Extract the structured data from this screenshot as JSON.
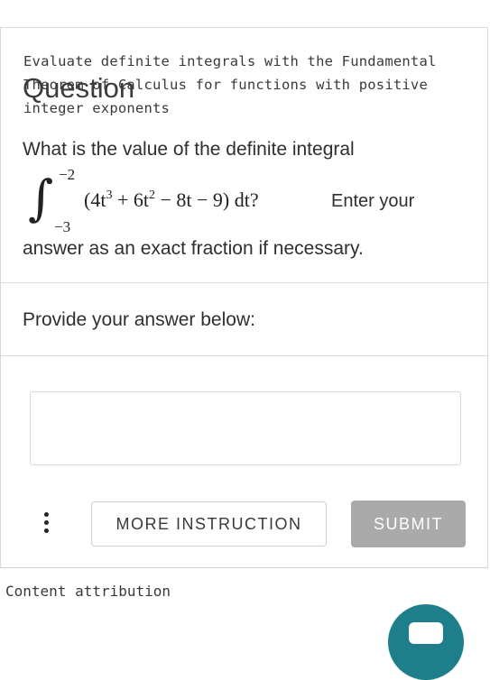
{
  "topic": "Evaluate definite integrals with the Fundamental Theorem of Calculus for functions with positive integer exponents",
  "question_title": "Question",
  "question": {
    "intro": "What is the value of the definite integral",
    "upper_limit": "−2",
    "lower_limit": "−3",
    "expression": "(4t³ + 6t² − 8t − 9) dt?",
    "enter_text": "Enter your",
    "tail": "answer as an exact fraction if necessary."
  },
  "answer_section": {
    "label": "Provide your answer below:",
    "input_value": "",
    "input_placeholder": ""
  },
  "buttons": {
    "more_instruction": "MORE INSTRUCTION",
    "submit": "SUBMIT"
  },
  "footer": {
    "attribution": "Content attribution"
  },
  "colors": {
    "submit_bg": "#aaaaaa",
    "fab_bg": "#1e7f8a"
  },
  "icons": {
    "more_options": "kebab-vertical-icon",
    "fab": "chat-icon"
  }
}
